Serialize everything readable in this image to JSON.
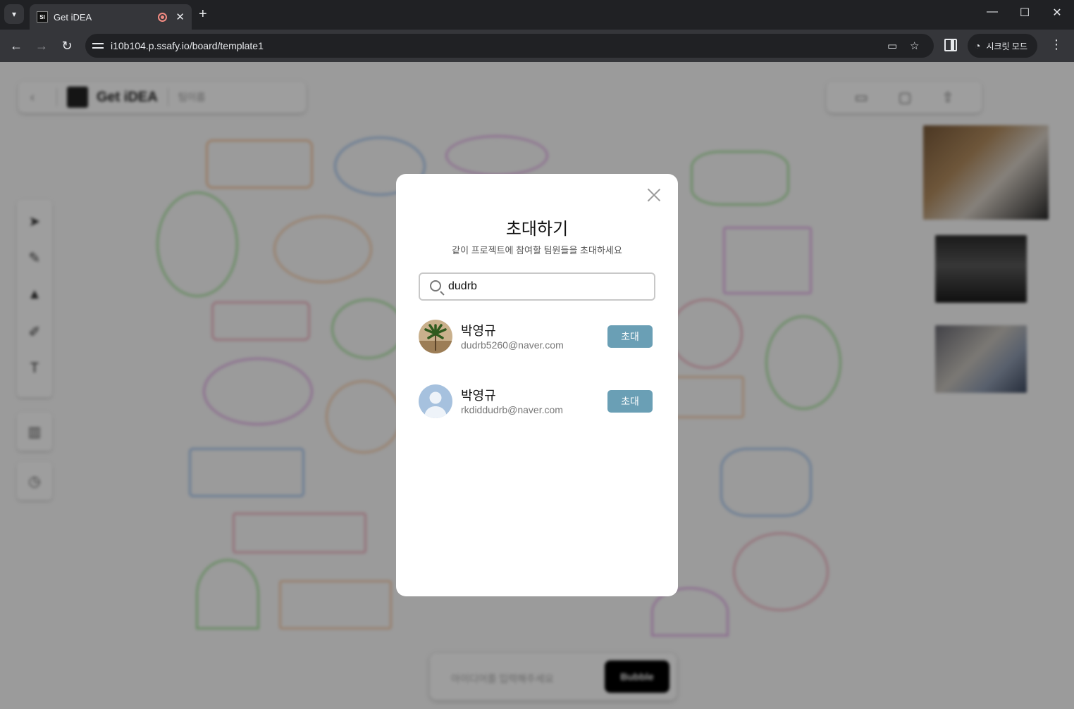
{
  "browser": {
    "tab_title": "Get iDEA",
    "tab_favicon": "SI",
    "url": "i10b104.p.ssafy.io/board/template1",
    "incognito_label": "시크릿 모드"
  },
  "board": {
    "header_title": "Get iDEA",
    "header_sub": "팀이름",
    "bottom_placeholder": "아이디어를 입력해주세요",
    "bottom_button": "Bubble"
  },
  "modal": {
    "title": "초대하기",
    "description": "같이 프로젝트에 참여할 팀원들을 초대하세요",
    "search_value": "dudrb",
    "users": [
      {
        "name": "박영규",
        "email": "dudrb5260@naver.com",
        "button": "초대"
      },
      {
        "name": "박영규",
        "email": "rkdiddudrb@naver.com",
        "button": "초대"
      }
    ]
  },
  "colors": {
    "invite_button": "#6a9fb5",
    "overlay": "rgba(0,0,0,0.38)"
  }
}
